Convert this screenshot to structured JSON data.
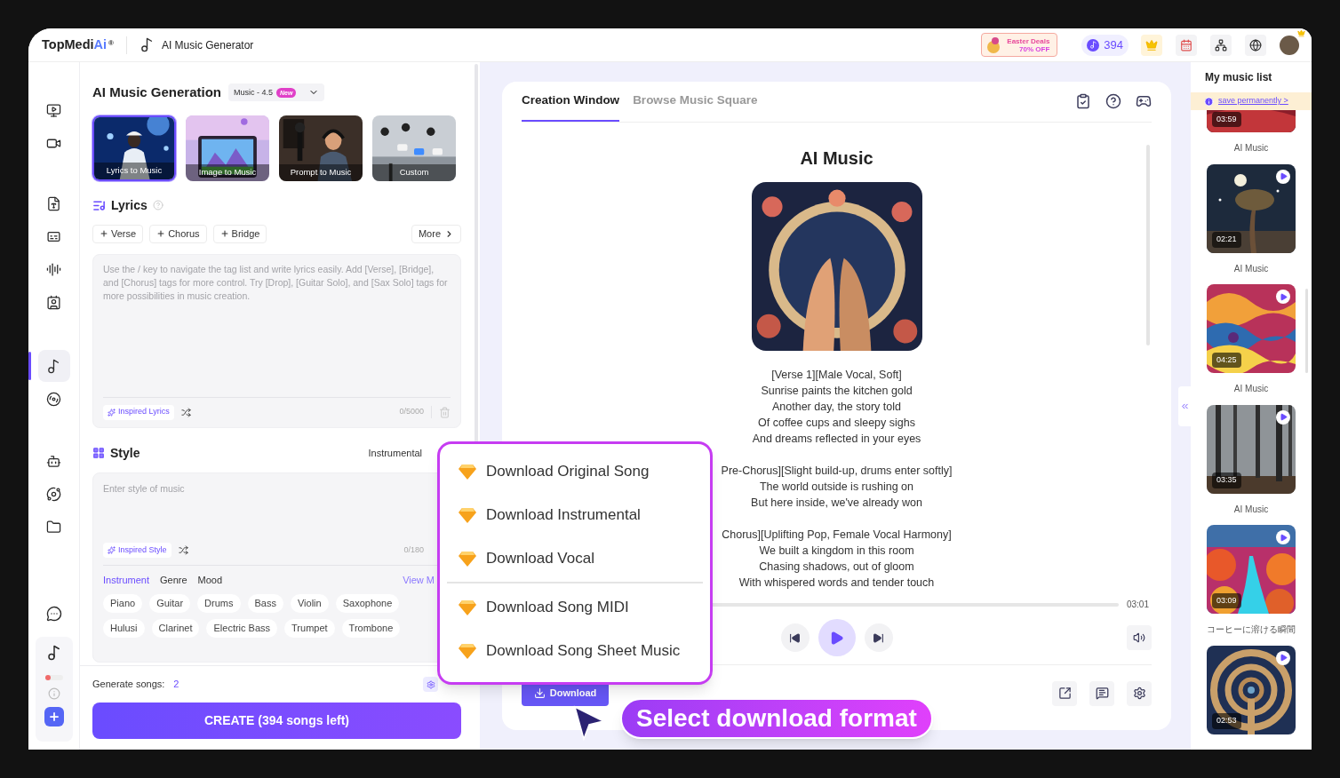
{
  "app": {
    "logo": "TopMedi",
    "logo_accent": "Ai",
    "logo_mark": "®",
    "page_title": "AI Music Generator"
  },
  "header": {
    "promo_line1": "Easter Deals",
    "promo_line2": "70% OFF",
    "credits": "394"
  },
  "rail": {
    "groups": [
      [
        {
          "kind": "monitor",
          "selected": false
        },
        {
          "kind": "camera",
          "selected": false
        }
      ],
      [
        {
          "kind": "text",
          "selected": false
        },
        {
          "kind": "captions",
          "selected": false
        },
        {
          "kind": "audio",
          "selected": false
        },
        {
          "kind": "contact",
          "selected": false
        }
      ],
      [
        {
          "kind": "music",
          "selected": true
        },
        {
          "kind": "disc",
          "selected": false
        }
      ],
      [
        {
          "kind": "bot",
          "selected": false
        },
        {
          "kind": "orbit",
          "selected": false
        },
        {
          "kind": "folder",
          "selected": false
        }
      ]
    ]
  },
  "generator": {
    "title": "AI Music Generation",
    "model": "Music - 4.5",
    "model_badge": "New",
    "modes": [
      {
        "label": "Lyrics to Music",
        "selected": true
      },
      {
        "label": "Image to Music",
        "selected": false
      },
      {
        "label": "Prompt to Music",
        "selected": false
      },
      {
        "label": "Custom",
        "selected": false
      }
    ]
  },
  "lyrics": {
    "heading": "Lyrics",
    "tags": [
      "Verse",
      "Chorus",
      "Bridge"
    ],
    "more": "More",
    "placeholder": "Use the / key to navigate the tag list and write lyrics easily. Add [Verse], [Bridge], and [Chorus] tags for more control. Try [Drop], [Guitar Solo], and [Sax Solo] tags for more possibilities in music creation.",
    "inspire": "Inspired Lyrics",
    "count": "0/5000"
  },
  "style": {
    "heading": "Style",
    "instrumental_label": "Instrumental",
    "placeholder": "Enter style of music",
    "inspire": "Inspired Style",
    "count": "0/180",
    "tabs": [
      {
        "label": "Instrument",
        "selected": true
      },
      {
        "label": "Genre",
        "selected": false
      },
      {
        "label": "Mood",
        "selected": false
      }
    ],
    "view_more": "View M",
    "chips": [
      [
        "Piano",
        "Guitar",
        "Drums",
        "Bass",
        "Violin",
        "Saxophone"
      ],
      [
        "Hulusi",
        "Clarinet",
        "Electric Bass",
        "Trumpet",
        "Trombone"
      ]
    ]
  },
  "rail_switch": {
    "on": false
  },
  "footer": {
    "generate_label": "Generate songs:",
    "generate_count": "2",
    "create": "CREATE (394 songs left)"
  },
  "creation": {
    "tabs": [
      {
        "label": "Creation Window",
        "selected": true
      },
      {
        "label": "Browse Music Square",
        "selected": false
      }
    ],
    "title": "AI Music",
    "stanzas": [
      [
        "[Verse 1][Male Vocal, Soft]",
        "Sunrise paints the kitchen gold",
        "Another day, the story told",
        "Of coffee cups and sleepy sighs",
        "And dreams reflected in your eyes"
      ],
      [
        "Pre-Chorus][Slight build-up, drums enter softly]",
        "The world outside is rushing on",
        "But here inside, we've already won"
      ],
      [
        "Chorus][Uplifting Pop, Female Vocal Harmony]",
        "We built a kingdom in this room",
        "Chasing shadows, out of gloom",
        "With whispered words and tender touch"
      ]
    ],
    "duration": "03:01",
    "download": "Download"
  },
  "download_menu": {
    "groups": [
      [
        "Download Original Song",
        "Download Instrumental",
        "Download Vocal"
      ],
      [
        "Download Song MIDI",
        "Download Song Sheet Music"
      ]
    ]
  },
  "callout": "Select download format",
  "music_list": {
    "title": "My music list",
    "notice": "save permanently >",
    "items": [
      {
        "duration": "03:59",
        "title": "AI Music"
      },
      {
        "duration": "02:21",
        "title": "AI Music"
      },
      {
        "duration": "04:25",
        "title": "AI Music"
      },
      {
        "duration": "03:35",
        "title": "AI Music"
      },
      {
        "duration": "03:09",
        "title": "コーヒーに溶ける瞬間"
      },
      {
        "duration": "02:53"
      }
    ]
  }
}
